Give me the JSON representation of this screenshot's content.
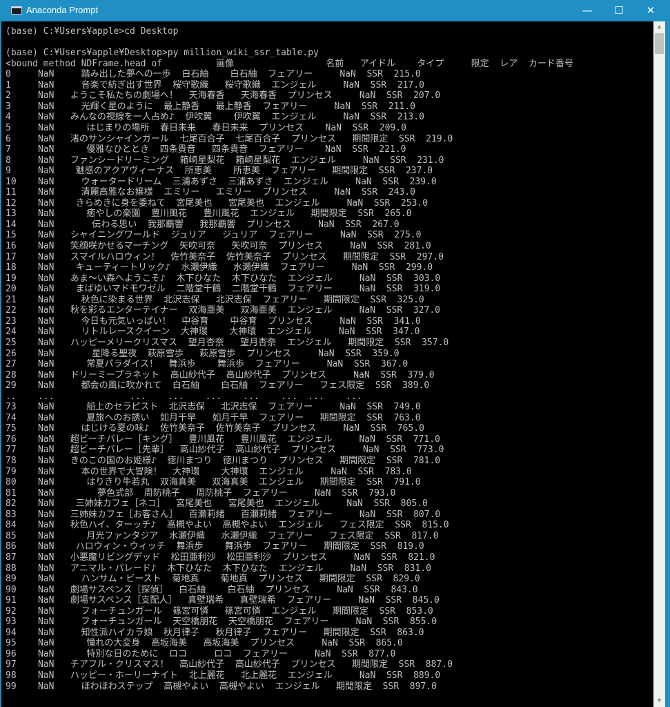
{
  "window": {
    "title": "Anaconda Prompt",
    "minimize": "—",
    "maximize": "☐",
    "close": "✕"
  },
  "console": {
    "lines": [
      "(base) C:¥Users¥apple>cd Desktop",
      "",
      "(base) C:¥Users¥apple¥Desktop>py million_wiki_ssr_table.py",
      "<bound method NDFrame.head of          画像                 名前   アイドル    タイプ     限定  レア  カード番号",
      "0     NaN     踏み出した夢への一歩  白石紬    白石紬  フェアリー     NaN  SSR  215.0",
      "1     NaN     音楽で紡ぎ出す世界  桜守歌織   桜守歌織  エンジェル     NaN  SSR  217.0",
      "2     NaN   ようこそ私たちの劇場へ！  天海春香   天海春香  プリンセス     NaN  SSR  207.0",
      "3     NaN     光輝く星のように  最上静香   最上静香  フェアリー     NaN  SSR  211.0",
      "4     NaN   みんなの視線を一人占め♪  伊吹翼    伊吹翼  エンジェル     NaN  SSR  213.0",
      "5     NaN      はじまりの場所  春日未来   春日未来  プリンセス    NaN  SSR  209.0",
      "6     NaN   渚のサンシャインガール  七尾百合子  七尾百合子  プリンセス   期間限定  SSR  219.0",
      "7     NaN      優雅なひととき  四条貴音   四条貴音  フェアリー    NaN  SSR  221.0",
      "8     NaN   ファンシードリーミング  箱崎星梨花  箱崎星梨花  エンジェル     NaN  SSR  231.0",
      "9     NaN    魅惑のアクアヴィーナス  所恵美    所恵美  フェアリー   期間限定  SSR  237.0",
      "10    NaN     ウォータードリーム  三浦あずさ  三浦あずさ  エンジェル     NaN  SSR  239.0",
      "11    NaN     清麗高雅なお嬢様  エミリー   エミリー  プリンセス     NaN  SSR  243.0",
      "12    NaN    きらめきに身を委ねて  宮尾美也   宮尾美也  エンジェル     NaN  SSR  253.0",
      "13    NaN      癒やしの楽園  豊川風花   豊川風花  エンジェル   期間限定  SSR  265.0",
      "14    NaN       伝わる思い  我那覇響   我那覇響  プリンセス     NaN  SSR  267.0",
      "15    NaN   シャイニングワールド  ジュリア   ジュリア  フェアリー     NaN  SSR  275.0",
      "16    NaN   笑顔咲かせるマーチング  矢吹可奈   矢吹可奈  プリンセス     NaN  SSR  281.0",
      "17    NaN   スマイルハロウィン！  佐竹美奈子  佐竹美奈子  プリンセス   期間限定  SSR  297.0",
      "18    NaN    キューティートリック♪  水瀬伊織   水瀬伊織  フェアリー     NaN  SSR  299.0",
      "19    NaN   あま～い森へようこそ♪  木下ひなた  木下ひなた  エンジェル     NaN  SSR  303.0",
      "20    NaN    まばゆいマドモワゼル  二階堂千鶴  二階堂千鶴  フェアリー     NaN  SSR  319.0",
      "21    NaN     秋色に染まる世界  北沢志保   北沢志保  フェアリー   期間限定  SSR  325.0",
      "22    NaN   秋を彩るエンターテイナー  双海亜美   双海亜美  エンジェル     NaN  SSR  327.0",
      "23    NaN     今日も元気いっぱい！  中谷育    中谷育  プリンセス     NaN  SSR  341.0",
      "24    NaN     リトルレースクイーン  大神環    大神環  エンジェル     NaN  SSR  347.0",
      "25    NaN   ハッピーメリークリスマス  望月杏奈   望月杏奈  エンジェル   期間限定  SSR  357.0",
      "26    NaN       星降る聖夜  萩原雪歩   萩原雪歩  プリンセス     NaN  SSR  359.0",
      "27    NaN      常夏パラダイス！  舞浜歩    舞浜歩  フェアリー     NaN  SSR  367.0",
      "28    NaN   ドリーミープラネット  高山紗代子  高山紗代子  プリンセス     NaN  SSR  379.0",
      "29    NaN     都会の風に吹かれて  白石紬    白石紬  フェアリー   フェス限定  SSR  389.0",
      "..    ...              ...    ...    ...    ...    ...  ...    ...",
      "73    NaN      船上のセラピスト  北沢志保   北沢志保  フェアリー     NaN  SSR  749.0",
      "74    NaN      夏旅へのお誘い  如月千早   如月千早  フェアリー   期間限定  SSR  763.0",
      "75    NaN     はじける夏の味♪  佐竹美奈子  佐竹美奈子  プリンセス     NaN  SSR  765.0",
      "76    NaN   超ビーチバレー［キング］  豊川風花   豊川風花  エンジェル     NaN  SSR  771.0",
      "77    NaN   超ビーチバレー［先輩］  高山紗代子  高山紗代子  プリンセス     NaN  SSR  773.0",
      "78    NaN   きのこの国のお姫様♪  徳川まつり  徳川まつり  プリンセス   期間限定  SSR  781.0",
      "79    NaN     本の世界で大冒険！  大神環    大神環  エンジェル     NaN  SSR  783.0",
      "80    NaN      はりきり牛若丸  双海真美   双海真美  エンジェル   期間限定  SSR  791.0",
      "81    NaN        夢色式部  周防桃子   周防桃子  フェアリー     NaN  SSR  793.0",
      "82    NaN    三姉妹カフェ［ネコ］  宮尾美也   宮尾美也  エンジェル     NaN  SSR  805.0",
      "83    NaN   三姉妹カフェ［お客さん］  百瀬莉緒   百瀬莉緒  フェアリー     NaN  SSR  807.0",
      "84    NaN   秋色ハイ、ターッチ♪  高槻やよい  高槻やよい  エンジェル   フェス限定  SSR  815.0",
      "85    NaN      月光ファンタジア  水瀬伊織   水瀬伊織  フェアリー   フェス限定  SSR  817.0",
      "86    NaN    ハロウィン・ウィッチ  舞浜歩    舞浜歩  フェアリー   期間限定  SSR  819.0",
      "87    NaN   小悪魔リビングデッド  松田亜利沙  松田亜利沙  プリンセス     NaN  SSR  821.0",
      "88    NaN   アニマル・パレード♪  木下ひなた  木下ひなた  エンジェル     NaN  SSR  831.0",
      "89    NaN     ハンサム・ビースト  菊地真    菊地真  プリンセス   期間限定  SSR  829.0",
      "90    NaN   劇場サスペンス［探偵］  白石紬    白石紬  プリンセス     NaN  SSR  843.0",
      "91    NaN   劇場サスペンス［支配人］  真壁瑞希   真壁瑞希  フェアリー     NaN  SSR  845.0",
      "92    NaN     フォーチュンガール  篠宮可憐   篠宮可憐  エンジェル   期間限定  SSR  853.0",
      "93    NaN     フォーチュンガール  天空橋朋花  天空橋朋花  フェアリー     NaN  SSR  855.0",
      "94    NaN     知性派ハイカラ娘  秋月律子   秋月律子  フェアリー   期間限定  SSR  863.0",
      "95    NaN      憧れの大変身  高坂海美   高坂海美  プリンセス     NaN  SSR  865.0",
      "96    NaN      特別な日のために  ロコ     ロコ  フェアリー     NaN  SSR  877.0",
      "97    NaN   チアフル・クリスマス！  高山紗代子  高山紗代子  プリンセス   期間限定  SSR  887.0",
      "98    NaN   ハッピー・ホーリーナイト  北上麗花   北上麗花  エンジェル     NaN  SSR  889.0",
      "99    NaN     ほわほわステップ  高槻やよい  高槻やよい  エンジェル   期間限定  SSR  897.0"
    ]
  }
}
